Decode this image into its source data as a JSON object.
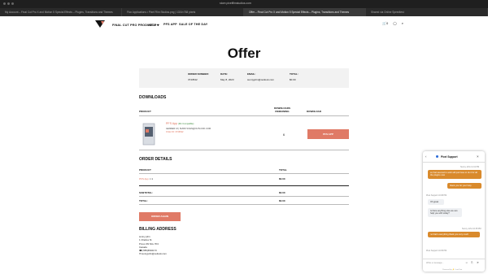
{
  "browser": {
    "address": "store.pixelfilmstudios.com",
    "tabs": [
      "My Account – Final Cut Pro X and Motion 5 Special Effects – Plugins, Transitions and Themes",
      "Flux Applications • Pixel Film Studios.png | 1024×768 pixels",
      "Offer – Final Cut Pro X and Motion 5 Special Effects – Plugins, Transitions and Themes",
      "Shared via Online Speedtest"
    ],
    "active_tab": 2
  },
  "nav": {
    "items": [
      "FINAL CUT PRO PRODUCTS ▾",
      "HELP ▾",
      "PFS APP",
      "SALE OF THE DAY"
    ],
    "cart_count": "0"
  },
  "page": {
    "title": "Offer",
    "summary": {
      "order_label": "ORDER NUMBER:",
      "order_value": "3743542",
      "date_label": "DATE:",
      "date_value": "May 8, 2023",
      "email_label": "EMAIL:",
      "email_value": "sunnyjohn@outlook.com",
      "total_label": "TOTAL:",
      "total_value": "$0.00"
    },
    "downloads": {
      "heading": "DOWNLOADS",
      "col_product": "PRODUCT",
      "col_remaining": "DOWNLOADS REMAINING",
      "col_download": "DOWNLOAD",
      "product_name": "PFS App",
      "compat": "(M1 Compatible)",
      "sub1": "GENDER: M | SUNNYJOHN@OUTLOOK.COM",
      "order_id": "Order ID: 3743542",
      "remaining": "6",
      "button": "PFS APP"
    },
    "order_details": {
      "heading": "ORDER DETAILS",
      "col_product": "PRODUCT",
      "col_total": "TOTAL",
      "item": "PFS App",
      "item_qty": "× 1",
      "item_total": "$0.00",
      "subtotal_label": "SUBTOTAL:",
      "subtotal_value": "$0.00",
      "total_label": "TOTAL:",
      "total_value": "$0.00",
      "order_again": "ORDER AGAIN"
    },
    "billing": {
      "heading": "BILLING ADDRESS",
      "lines": [
        "sunny john",
        "1 Charles St",
        "Provo ON N1L 7K3",
        "Canada",
        "☎ (555)6502173",
        "✉ sunnyjohn@outlook.com"
      ]
    }
  },
  "chat": {
    "agent": "Pixel Support",
    "messages": [
      {
        "who": "me",
        "ts": "Sunny John 11:11 PM",
        "text": "so that seemed to work will just have to do it for all the plugins now"
      },
      {
        "who": "me",
        "ts": "",
        "text": "thank you for your help"
      },
      {
        "who": "them",
        "ts": "Pixel Support 10:38 PM",
        "text": "Oh great"
      },
      {
        "who": "them",
        "ts": "",
        "text": "is there anything else we can help you with today?"
      },
      {
        "who": "me",
        "ts": "Sunny John 10:38 PM",
        "text": "no that's everything thank you very much"
      },
      {
        "who": "them",
        "ts": "Pixel Support 10:35 PM",
        "text": ""
      }
    ],
    "input_placeholder": "Write a message...",
    "powered": "Powered by ⚡ LiveChat"
  },
  "colors": {
    "accent": "#e07a66",
    "chat_me": "#d98a2c"
  }
}
